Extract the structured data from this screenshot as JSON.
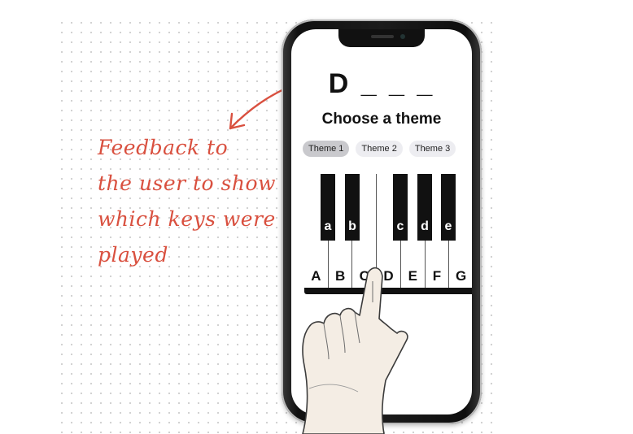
{
  "annotation": {
    "lines": [
      "Feedback to",
      "the user to show",
      "which keys were",
      "played"
    ],
    "color": "#d9503f"
  },
  "app": {
    "guess_display": "D _ _ _",
    "theme_title": "Choose a theme",
    "themes": [
      {
        "label": "Theme 1",
        "selected": true
      },
      {
        "label": "Theme 2",
        "selected": false
      },
      {
        "label": "Theme 3",
        "selected": false
      }
    ],
    "white_keys": [
      "A",
      "B",
      "C",
      "D",
      "E",
      "F",
      "G"
    ],
    "black_keys": [
      "a",
      "b",
      "c",
      "d",
      "e"
    ]
  }
}
